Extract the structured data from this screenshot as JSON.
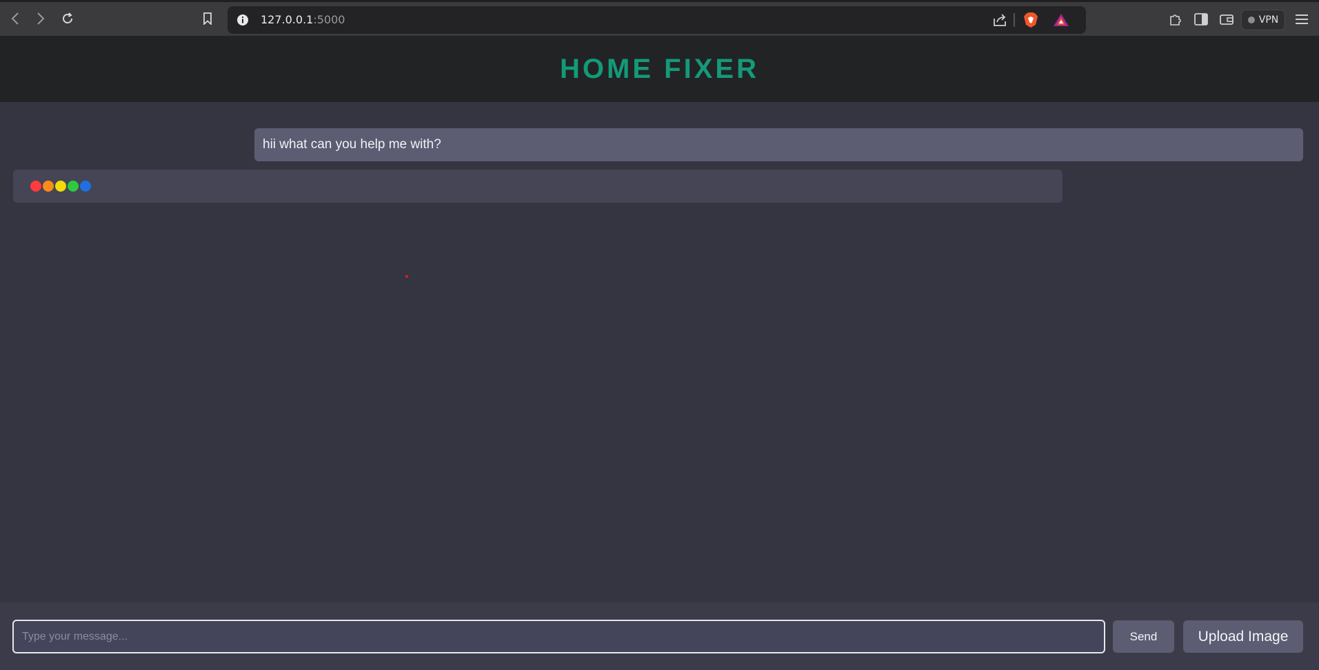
{
  "browser": {
    "url_host": "127.0.0.1",
    "url_port": ":5000",
    "vpn_label": "VPN",
    "icons": [
      "back-icon",
      "forward-icon",
      "reload-icon",
      "bookmark-icon",
      "info-icon",
      "share-icon",
      "brave-shield-icon",
      "brave-rewards-icon",
      "extensions-icon",
      "sidebar-icon",
      "wallet-icon",
      "menu-icon"
    ]
  },
  "app": {
    "title": "HOME FIXER",
    "accent_color": "#139a79"
  },
  "chat": {
    "messages": [
      {
        "role": "user",
        "text": "hii what can you help me with?"
      }
    ],
    "typing_indicator_colors": [
      "#ff3b3b",
      "#ff8c1a",
      "#f5d90a",
      "#2fc940",
      "#1f6fe0"
    ]
  },
  "input": {
    "placeholder": "Type your message...",
    "value": ""
  },
  "buttons": {
    "send_label": "Send",
    "upload_label": "Upload Image"
  }
}
